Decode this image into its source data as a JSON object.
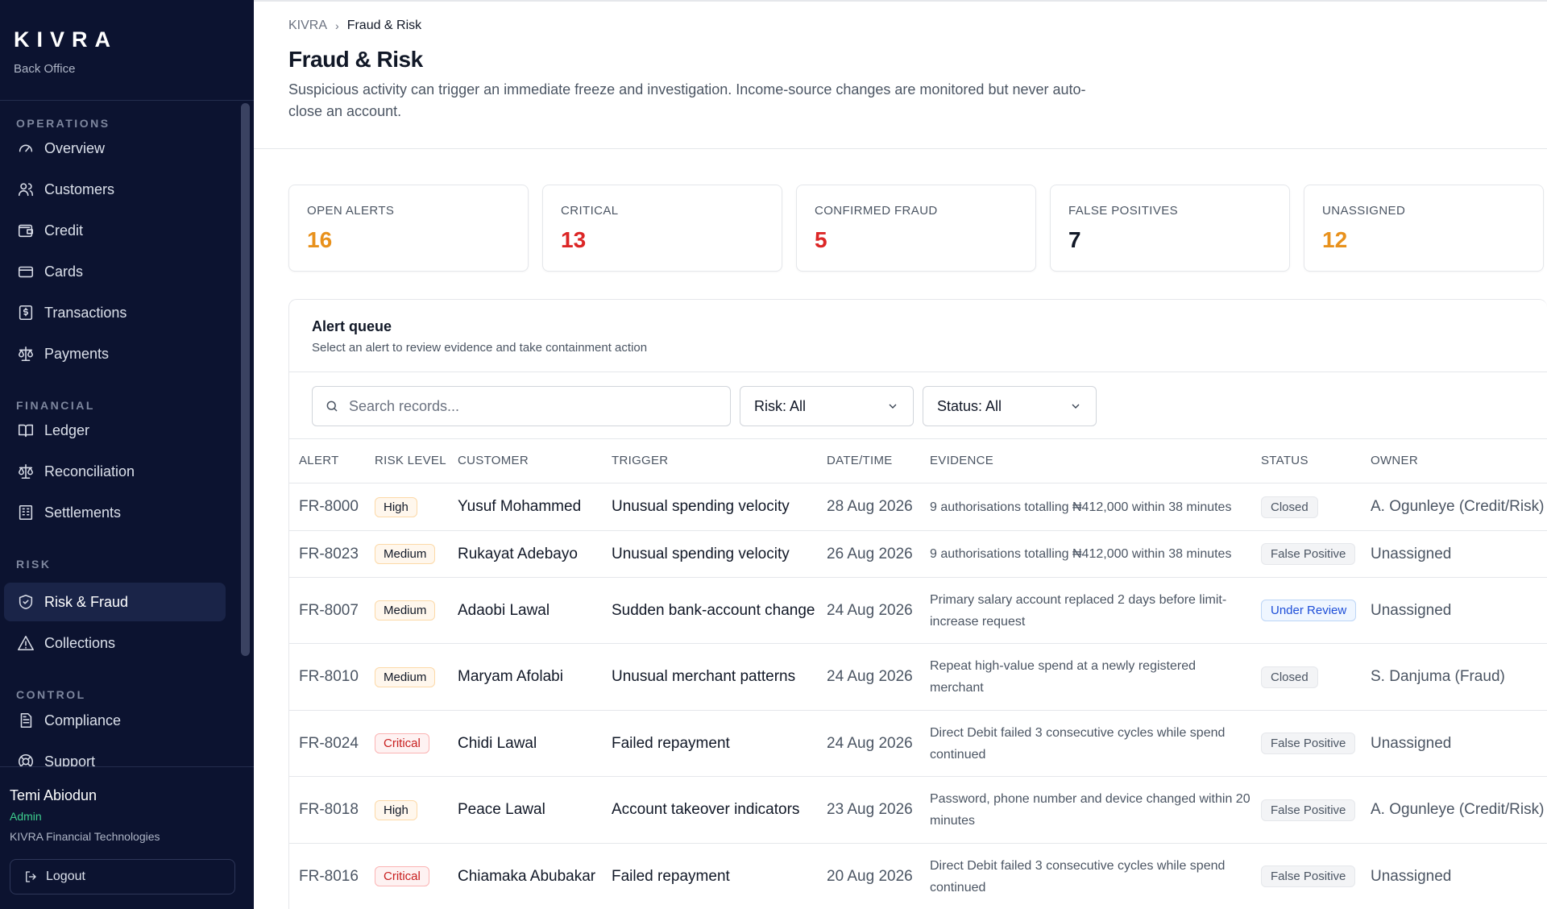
{
  "sidebar": {
    "brand": "KIVRA",
    "brand_sub": "Back Office",
    "sections": {
      "operations": "OPERATIONS",
      "financial": "FINANCIAL",
      "risk": "RISK",
      "control": "CONTROL"
    },
    "items": {
      "overview": "Overview",
      "customers": "Customers",
      "credit": "Credit",
      "cards": "Cards",
      "transactions": "Transactions",
      "payments": "Payments",
      "ledger": "Ledger",
      "reconciliation": "Reconciliation",
      "settlements": "Settlements",
      "risk_fraud": "Risk & Fraud",
      "collections": "Collections",
      "compliance": "Compliance",
      "support": "Support"
    },
    "icons": {
      "overview": "gauge-icon",
      "customers": "users-icon",
      "credit": "wallet-icon",
      "cards": "card-icon",
      "transactions": "receipt-icon",
      "payments": "scale-icon",
      "ledger": "book-icon",
      "reconciliation": "scale-icon",
      "settlements": "building-icon",
      "risk_fraud": "shield-check-icon",
      "collections": "warning-icon",
      "compliance": "document-icon",
      "support": "lifebuoy-icon"
    },
    "active": "Risk & Fraud",
    "user": {
      "name": "Temi Abiodun",
      "role": "Admin",
      "org": "KIVRA Financial Technologies"
    },
    "logout_label": "Logout"
  },
  "header": {
    "breadcrumb_root": "KIVRA",
    "breadcrumb_current": "Fraud & Risk",
    "title": "Fraud & Risk",
    "description": "Suspicious activity can trigger an immediate freeze and investigation. Income-source changes are monitored but never auto-close an account."
  },
  "stats": [
    {
      "label": "OPEN ALERTS",
      "value": "16",
      "color": "#e8911c"
    },
    {
      "label": "CRITICAL",
      "value": "13",
      "color": "#dc2626"
    },
    {
      "label": "CONFIRMED FRAUD",
      "value": "5",
      "color": "#dc2626"
    },
    {
      "label": "FALSE POSITIVES",
      "value": "7",
      "color": "#111827"
    },
    {
      "label": "UNASSIGNED",
      "value": "12",
      "color": "#e8911c"
    }
  ],
  "queue": {
    "title": "Alert queue",
    "subtitle": "Select an alert to review evidence and take containment action",
    "search_placeholder": "Search records...",
    "risk_filter": "Risk: All",
    "status_filter": "Status: All",
    "columns": [
      "ALERT",
      "RISK LEVEL",
      "CUSTOMER",
      "TRIGGER",
      "DATE/TIME",
      "EVIDENCE",
      "STATUS",
      "OWNER"
    ],
    "rows": [
      {
        "id": "FR-8000",
        "risk": "High",
        "customer": "Yusuf Mohammed",
        "trigger": "Unusual spending velocity",
        "date": "28 Aug 2026",
        "evidence": "9 authorisations totalling ₦412,000 within 38 minutes",
        "status": "Closed",
        "owner": "A. Ogunleye (Credit/Risk)"
      },
      {
        "id": "FR-8023",
        "risk": "Medium",
        "customer": "Rukayat Adebayo",
        "trigger": "Unusual spending velocity",
        "date": "26 Aug 2026",
        "evidence": "9 authorisations totalling ₦412,000 within 38 minutes",
        "status": "False Positive",
        "owner": "Unassigned"
      },
      {
        "id": "FR-8007",
        "risk": "Medium",
        "customer": "Adaobi Lawal",
        "trigger": "Sudden bank-account change",
        "date": "24 Aug 2026",
        "evidence": "Primary salary account replaced 2 days before limit-increase request",
        "status": "Under Review",
        "owner": "Unassigned"
      },
      {
        "id": "FR-8010",
        "risk": "Medium",
        "customer": "Maryam Afolabi",
        "trigger": "Unusual merchant patterns",
        "date": "24 Aug 2026",
        "evidence": "Repeat high-value spend at a newly registered merchant",
        "status": "Closed",
        "owner": "S. Danjuma (Fraud)"
      },
      {
        "id": "FR-8024",
        "risk": "Critical",
        "customer": "Chidi Lawal",
        "trigger": "Failed repayment",
        "date": "24 Aug 2026",
        "evidence": "Direct Debit failed 3 consecutive cycles while spend continued",
        "status": "False Positive",
        "owner": "Unassigned"
      },
      {
        "id": "FR-8018",
        "risk": "High",
        "customer": "Peace Lawal",
        "trigger": "Account takeover indicators",
        "date": "23 Aug 2026",
        "evidence": "Password, phone number and device changed within 20 minutes",
        "status": "False Positive",
        "owner": "A. Ogunleye (Credit/Risk)"
      },
      {
        "id": "FR-8016",
        "risk": "Critical",
        "customer": "Chiamaka Abubakar",
        "trigger": "Failed repayment",
        "date": "20 Aug 2026",
        "evidence": "Direct Debit failed 3 consecutive cycles while spend continued",
        "status": "False Positive",
        "owner": "Unassigned"
      }
    ]
  }
}
